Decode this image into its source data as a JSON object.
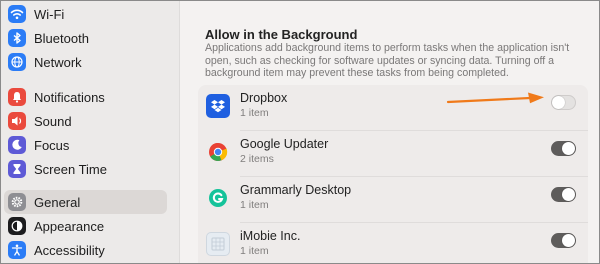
{
  "sidebar": {
    "items": [
      {
        "label": "Wi-Fi",
        "icon": "wifi-icon",
        "color": "#2b7cf6"
      },
      {
        "label": "Bluetooth",
        "icon": "bluetooth-icon",
        "color": "#2b7cf6"
      },
      {
        "label": "Network",
        "icon": "globe-icon",
        "color": "#2b7cf6"
      },
      {
        "label": "Notifications",
        "icon": "bell-icon",
        "color": "#ea4a3d"
      },
      {
        "label": "Sound",
        "icon": "speaker-icon",
        "color": "#ea4a3d"
      },
      {
        "label": "Focus",
        "icon": "moon-icon",
        "color": "#5e5ad6"
      },
      {
        "label": "Screen Time",
        "icon": "hourglass-icon",
        "color": "#5e5ad6"
      },
      {
        "label": "General",
        "icon": "gear-icon",
        "color": "#8e8e93",
        "selected": true
      },
      {
        "label": "Appearance",
        "icon": "appearance-icon",
        "color": "#1c1c1e"
      },
      {
        "label": "Accessibility",
        "icon": "accessibility-icon",
        "color": "#2b7cf6"
      }
    ]
  },
  "main": {
    "heading": "Allow in the Background",
    "description": "Applications add background items to perform tasks when the application isn't open, such as checking for software updates or syncing data. Turning off a background item may prevent these tasks from being completed.",
    "apps": [
      {
        "name": "Dropbox",
        "count": "1 item",
        "enabled": false,
        "icon": "dropbox-icon"
      },
      {
        "name": "Google Updater",
        "count": "2 items",
        "enabled": true,
        "icon": "chrome-icon"
      },
      {
        "name": "Grammarly Desktop",
        "count": "1 item",
        "enabled": true,
        "icon": "grammarly-icon"
      },
      {
        "name": "iMobie Inc.",
        "count": "1 item",
        "enabled": true,
        "icon": "generic-app-icon"
      }
    ]
  },
  "annotation": {
    "arrow_color": "#f07a1a"
  }
}
